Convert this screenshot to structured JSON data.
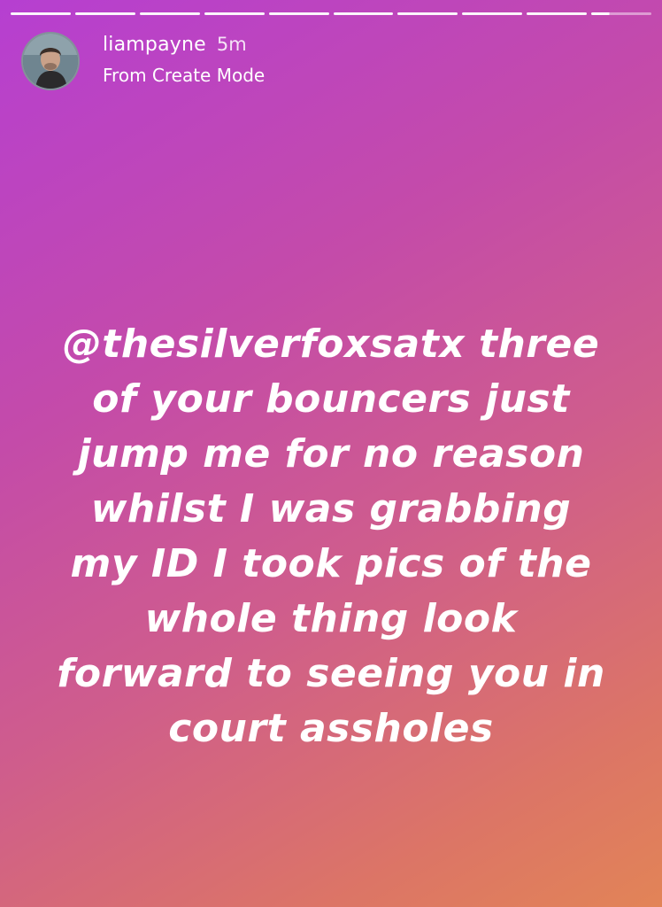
{
  "story": {
    "progress_segments": 10,
    "active_segment_fill": 0.3
  },
  "header": {
    "username": "liampayne",
    "time": "5m",
    "subtitle": "From Create Mode",
    "avatar_icon": "profile-avatar"
  },
  "caption": {
    "lines": [
      "@thesilverfoxsatx three",
      "of your bouncers just",
      "jump me for no reason",
      "whilst I was grabbing",
      "my ID I took pics of the",
      "whole thing look",
      "forward to seeing you in",
      "court assholes"
    ]
  },
  "colors": {
    "gradient_start": "#b63fd1",
    "gradient_end": "#e28457",
    "text": "#ffffff"
  }
}
